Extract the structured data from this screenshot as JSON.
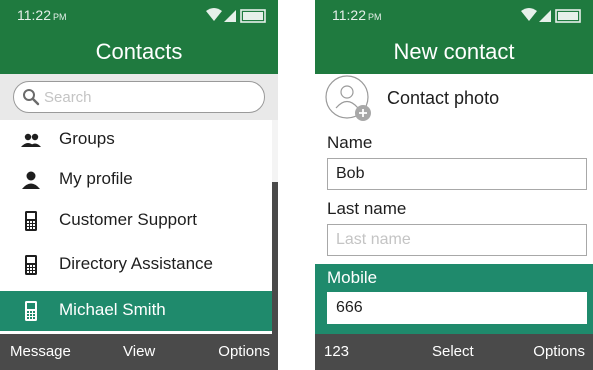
{
  "status": {
    "time": "11:22",
    "ampm": "PM"
  },
  "contacts_screen": {
    "title": "Contacts",
    "search": {
      "placeholder": "Search",
      "value": ""
    },
    "items": [
      {
        "label": "Groups",
        "icon": "groups-icon"
      },
      {
        "label": "My profile",
        "icon": "person-icon"
      },
      {
        "label": "Customer Support",
        "icon": "phone-device-icon"
      },
      {
        "label": "Directory Assistance",
        "icon": "phone-device-icon"
      },
      {
        "label": "Michael Smith",
        "icon": "phone-device-icon",
        "selected": true
      }
    ],
    "softkeys": {
      "left": "Message",
      "center": "View",
      "right": "Options"
    }
  },
  "new_contact_screen": {
    "title": "New contact",
    "photo_label": "Contact photo",
    "fields": {
      "name": {
        "label": "Name",
        "value": "Bob",
        "placeholder": ""
      },
      "last_name": {
        "label": "Last name",
        "value": "",
        "placeholder": "Last name"
      },
      "mobile": {
        "label": "Mobile",
        "value": "666",
        "placeholder": ""
      }
    },
    "softkeys": {
      "left": "123",
      "center": "Select",
      "right": "Options"
    }
  },
  "colors": {
    "header_green": "#1f7a3f",
    "selection_teal": "#1f8a6c",
    "softkey_bar": "#4a4a4a",
    "search_bg": "#e9e9e9"
  }
}
